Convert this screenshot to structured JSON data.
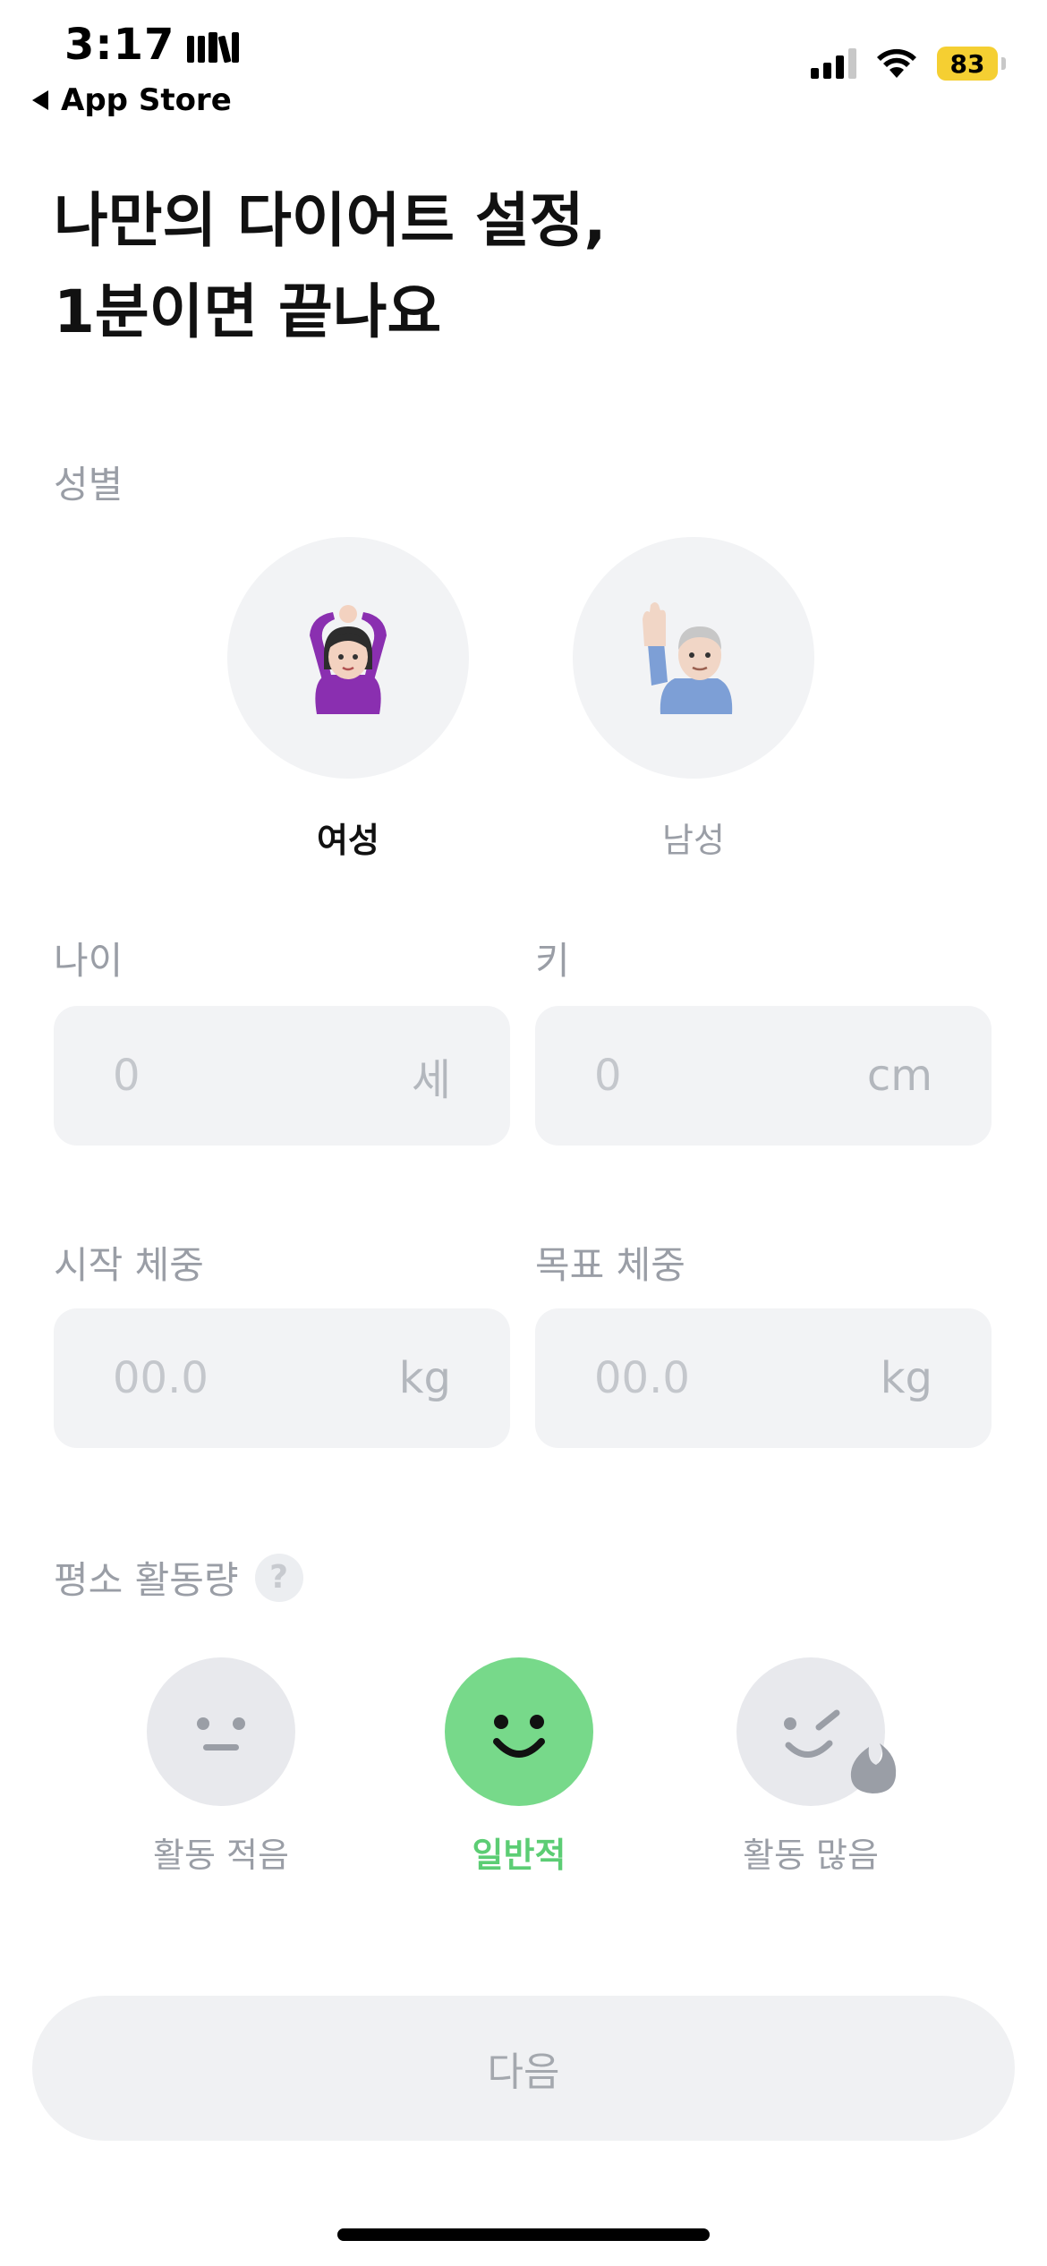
{
  "status_bar": {
    "time": "3:17",
    "back_label": "App Store",
    "battery": "83"
  },
  "title": {
    "line1": "나만의 다이어트 설정,",
    "line2": "1분이면 끝나요"
  },
  "gender": {
    "label": "성별",
    "options": [
      {
        "label": "여성",
        "selected": true
      },
      {
        "label": "남성",
        "selected": false
      }
    ]
  },
  "age": {
    "label": "나이",
    "placeholder": "0",
    "unit": "세"
  },
  "height": {
    "label": "키",
    "placeholder": "0",
    "unit": "cm"
  },
  "start_weight": {
    "label": "시작 체중",
    "placeholder": "00.0",
    "unit": "kg"
  },
  "goal_weight": {
    "label": "목표 체중",
    "placeholder": "00.0",
    "unit": "kg"
  },
  "activity": {
    "label": "평소 활동량",
    "help": "?",
    "options": [
      {
        "label": "활동 적음",
        "icon": "neutral-face-icon",
        "selected": false
      },
      {
        "label": "일반적",
        "icon": "smile-face-icon",
        "selected": true
      },
      {
        "label": "활동 많음",
        "icon": "wink-flame-face-icon",
        "selected": false
      }
    ]
  },
  "next_button": {
    "label": "다음"
  },
  "colors": {
    "accent_green": "#77d98a",
    "accent_green_text": "#5ccd74",
    "field_bg": "#f2f3f5",
    "muted_text": "#9a9ea6",
    "battery": "#f5cf32"
  }
}
